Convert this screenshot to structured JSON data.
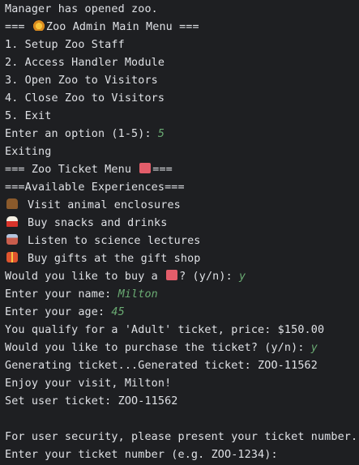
{
  "terminal": {
    "l01": "Manager has opened zoo.",
    "l02a": "=== ",
    "l02b": "Zoo Admin Main Menu ===",
    "l03": "1. Setup Zoo Staff",
    "l04": "2. Access Handler Module",
    "l05": "3. Open Zoo to Visitors",
    "l06": "4. Close Zoo to Visitors",
    "l07": "5. Exit",
    "l08a": "Enter an option (1-5): ",
    "l08b": "5",
    "l09": "Exiting",
    "l10a": "=== Zoo Ticket Menu ",
    "l10b": "===",
    "l11": "===Available Experiences===",
    "l12": "Visit animal enclosures",
    "l13": "Buy snacks and drinks",
    "l14": "Listen to science lectures",
    "l15": "Buy gifts at the gift shop",
    "l16a": "Would you like to buy a ",
    "l16b": "? (y/n): ",
    "l16c": "y",
    "l17a": "Enter your name: ",
    "l17b": "Milton",
    "l18a": "Enter your age: ",
    "l18b": "45",
    "l19": "You qualify for a 'Adult' ticket, price: $150.00",
    "l20a": "Would you like to purchase the ticket? (y/n): ",
    "l20b": "y",
    "l21": "Generating ticket...Generated ticket: ZOO-11562",
    "l22": "Enjoy your visit, Milton!",
    "l23": "Set user ticket: ZOO-11562",
    "l24": "",
    "l25": "For user security, please present your ticket number.",
    "l26": "Enter your ticket number (e.g. ZOO-1234):"
  },
  "icons": {
    "lion": "lion-face-icon",
    "ticket": "ticket-icon",
    "ox": "ox-icon",
    "popcorn": "popcorn-icon",
    "school": "school-icon",
    "gift": "gift-icon"
  },
  "colors": {
    "background": "#1e1f22",
    "text": "#dfe1e5",
    "user_input": "#6aab73"
  }
}
